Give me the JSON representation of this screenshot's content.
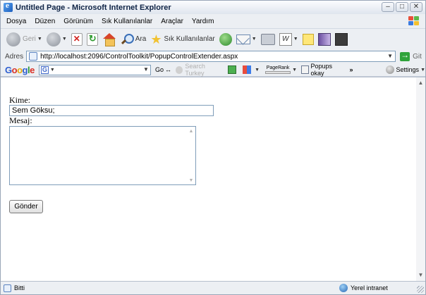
{
  "window": {
    "title": "Untitled Page - Microsoft Internet Explorer"
  },
  "menubar": {
    "items": [
      "Dosya",
      "Düzen",
      "Görünüm",
      "Sık Kullanılanlar",
      "Araçlar",
      "Yardım"
    ]
  },
  "toolbar": {
    "back_label": "Geri",
    "search_label": "Ara",
    "favorites_label": "Sık Kullanılanlar"
  },
  "addressbar": {
    "label": "Adres",
    "url": "http://localhost:2096/ControlToolkit/PopupControlExtender.aspx",
    "go_label": "Git"
  },
  "google_toolbar": {
    "logo": "Google",
    "go_label": "Go",
    "search_label": "Search Turkey",
    "pagerank_label": "PageRank",
    "popups_label": "Popups okay",
    "settings_label": "Settings"
  },
  "form": {
    "to_label": "Kime:",
    "to_value": "Sem Göksu;",
    "message_label": "Mesaj:",
    "message_value": "",
    "submit_label": "Gönder"
  },
  "statusbar": {
    "status": "Bitti",
    "zone": "Yerel intranet"
  },
  "colors": {
    "window_bg": "#eceff3",
    "input_border": "#7f9db9",
    "go_green": "#2fa33a"
  }
}
